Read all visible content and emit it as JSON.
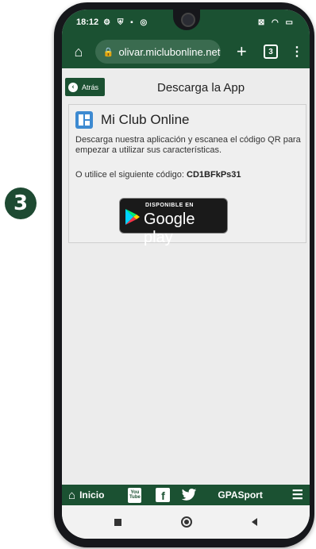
{
  "step": {
    "number": "3"
  },
  "status_bar": {
    "time": "18:12",
    "left_icons": [
      "settings-icon",
      "shield-icon",
      "message-icon",
      "whatsapp-icon"
    ],
    "right_icons": [
      "mute-icon",
      "wifi-icon",
      "battery-icon"
    ]
  },
  "browser": {
    "url": "olivar.miclubonline.net",
    "tab_count": "3"
  },
  "page": {
    "back_label": "Atrás",
    "title": "Descarga la App"
  },
  "card": {
    "app_name": "Mi Club Online",
    "description": "Descarga nuestra aplicación y escanea el código QR para empezar a utilizar sus características.",
    "code_prefix": "O utilice el siguiente código: ",
    "code": "CD1BFkPs31"
  },
  "google_play": {
    "small_text": "DISPONIBLE EN",
    "big_text": "Google play"
  },
  "bottom_nav": {
    "home_label": "Inicio",
    "youtube_text_top": "You",
    "youtube_text_bottom": "Tube",
    "facebook_text": "f",
    "brand": "GPASport"
  },
  "colors": {
    "brand_green": "#1b5132",
    "app_blue": "#3d8ad1",
    "step_badge": "#1e4a32"
  }
}
